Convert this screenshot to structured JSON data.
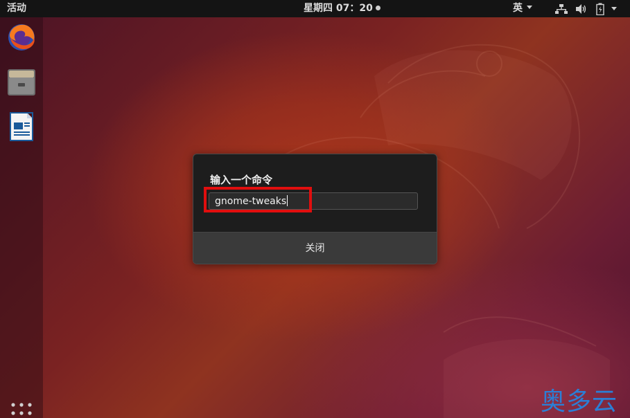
{
  "topbar": {
    "activities_label": "活动",
    "clock": "星期四 07：20",
    "input_method": "英"
  },
  "dock": {
    "items": [
      {
        "name": "firefox",
        "icon": "firefox-icon"
      },
      {
        "name": "files",
        "icon": "file-manager-icon"
      },
      {
        "name": "writer",
        "icon": "libreoffice-writer-icon"
      }
    ],
    "show_apps_icon": "apps-grid-icon"
  },
  "dialog": {
    "title": "输入一个命令",
    "input_value": "gnome-tweaks",
    "close_label": "关闭",
    "highlight_color": "#e10e0e"
  },
  "watermark": {
    "text": "奥多云",
    "color": "#2b7fd6"
  },
  "colors": {
    "topbar": "#141414",
    "dialog_bg": "#1d1d1d",
    "dialog_footer": "#3a3a3a"
  }
}
